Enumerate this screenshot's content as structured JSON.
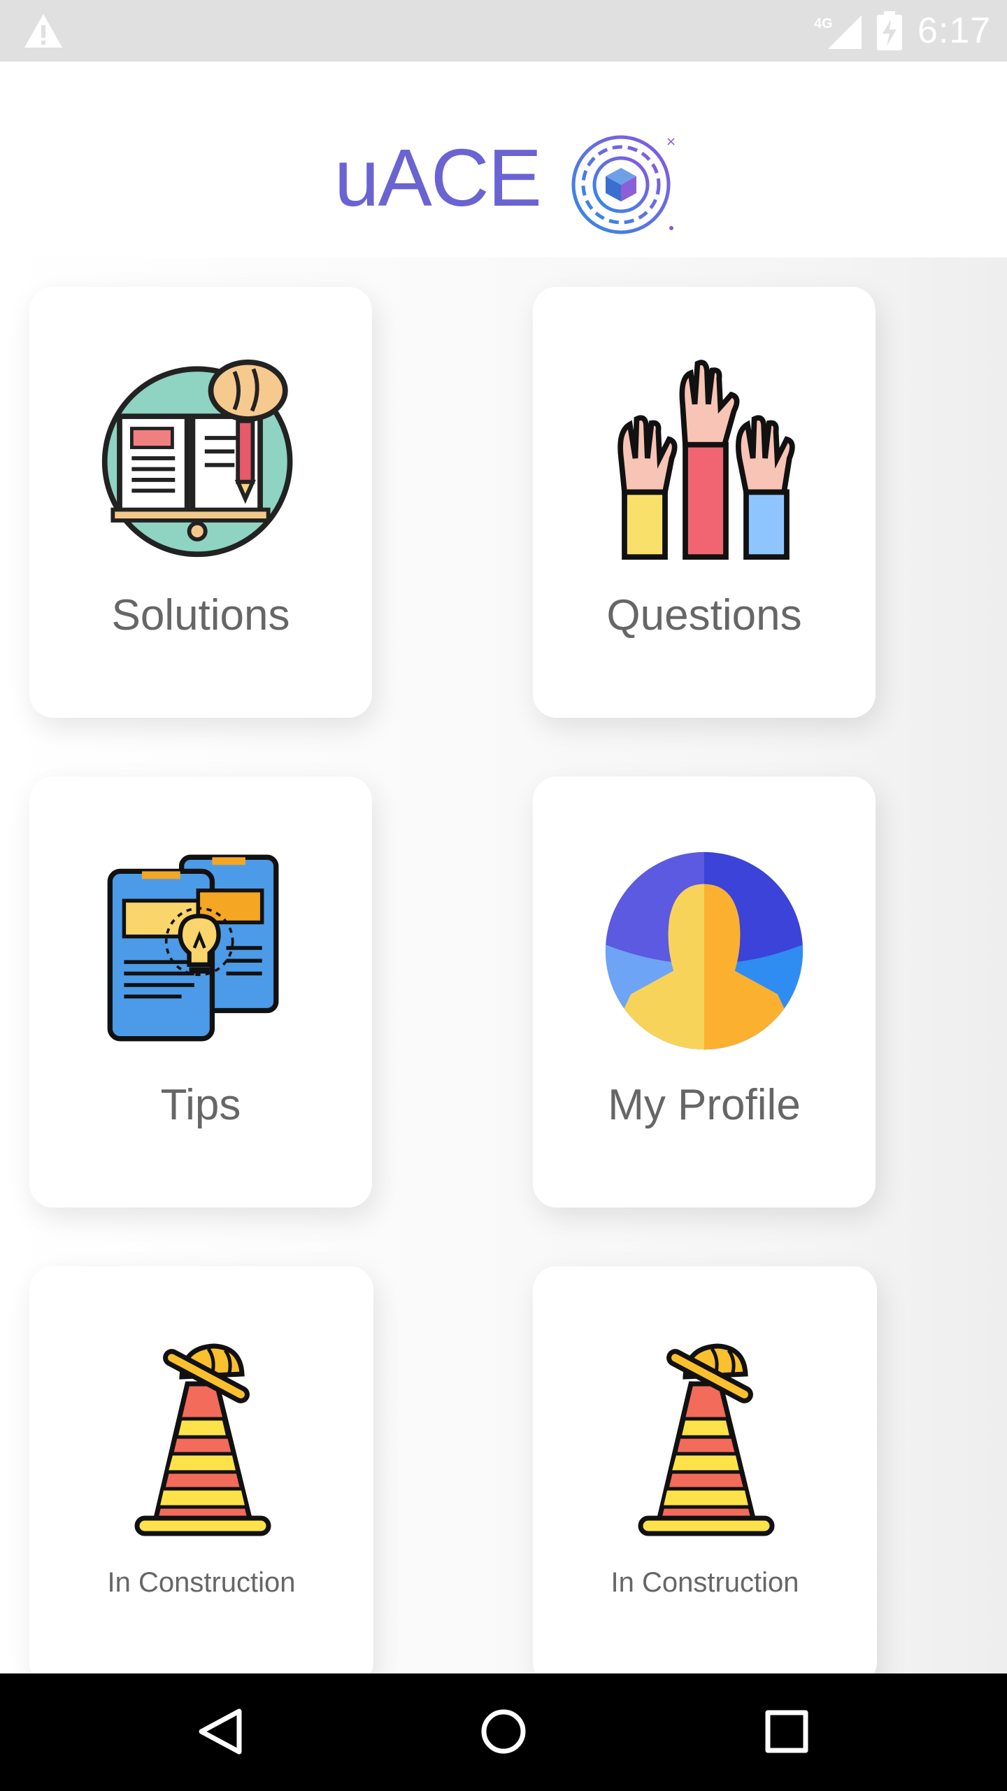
{
  "status_bar": {
    "time": "6:17",
    "network": "4G",
    "icons": [
      "warning-icon",
      "signal-icon",
      "battery-charging-icon"
    ]
  },
  "header": {
    "logo_text": "uACE",
    "logo_icon": "target-cube-icon",
    "brand_color": "#6a63d2"
  },
  "menu": {
    "items": [
      {
        "label": "Solutions",
        "icon": "book-brain-icon"
      },
      {
        "label": "Questions",
        "icon": "raised-hands-icon"
      },
      {
        "label": "Tips",
        "icon": "phone-lightbulb-icon"
      },
      {
        "label": "My Profile",
        "icon": "user-avatar-icon"
      },
      {
        "label": "In Construction",
        "icon": "traffic-cone-icon"
      },
      {
        "label": "In Construction",
        "icon": "traffic-cone-icon"
      }
    ]
  },
  "nav_bar": {
    "buttons": [
      "back-icon",
      "home-icon",
      "recents-icon"
    ]
  }
}
